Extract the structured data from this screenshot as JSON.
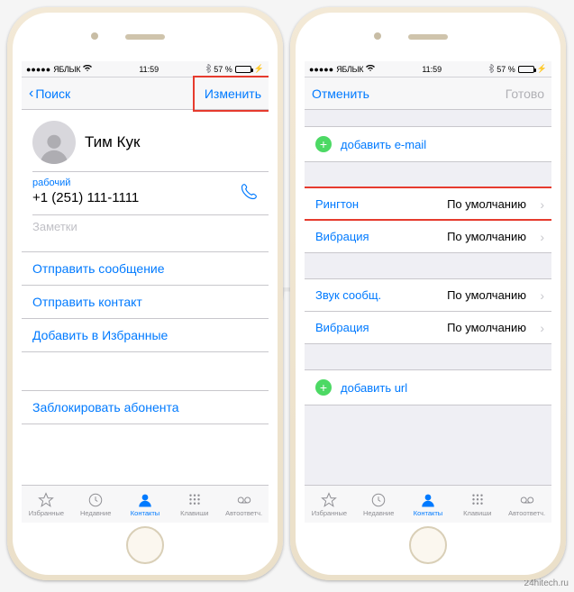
{
  "statusbar": {
    "carrier": "ЯБЛЫК",
    "time": "11:59",
    "battery_pct": "57 %"
  },
  "left_screen": {
    "nav_back": "Поиск",
    "nav_right": "Изменить",
    "contact_name": "Тим Кук",
    "phone_label": "рабочий",
    "phone_number": "+1 (251) 111-1111",
    "notes_placeholder": "Заметки",
    "actions": {
      "send_message": "Отправить сообщение",
      "send_contact": "Отправить контакт",
      "add_favorite": "Добавить в Избранные",
      "block": "Заблокировать абонента"
    }
  },
  "right_screen": {
    "nav_left": "Отменить",
    "nav_right": "Готово",
    "add_email": "добавить e-mail",
    "ringtone_label": "Рингтон",
    "ringtone_value": "По умолчанию",
    "vibration_label": "Вибрация",
    "vibration_value": "По умолчанию",
    "msg_sound_label": "Звук сообщ.",
    "msg_sound_value": "По умолчанию",
    "msg_vibration_label": "Вибрация",
    "msg_vibration_value": "По умолчанию",
    "add_url": "добавить url"
  },
  "tabs": {
    "favorites": "Избранные",
    "recents": "Недавние",
    "contacts": "Контакты",
    "keypad": "Клавиши",
    "voicemail": "Автоответч."
  },
  "watermark": "Яблык",
  "credit": "24hitech.ru"
}
